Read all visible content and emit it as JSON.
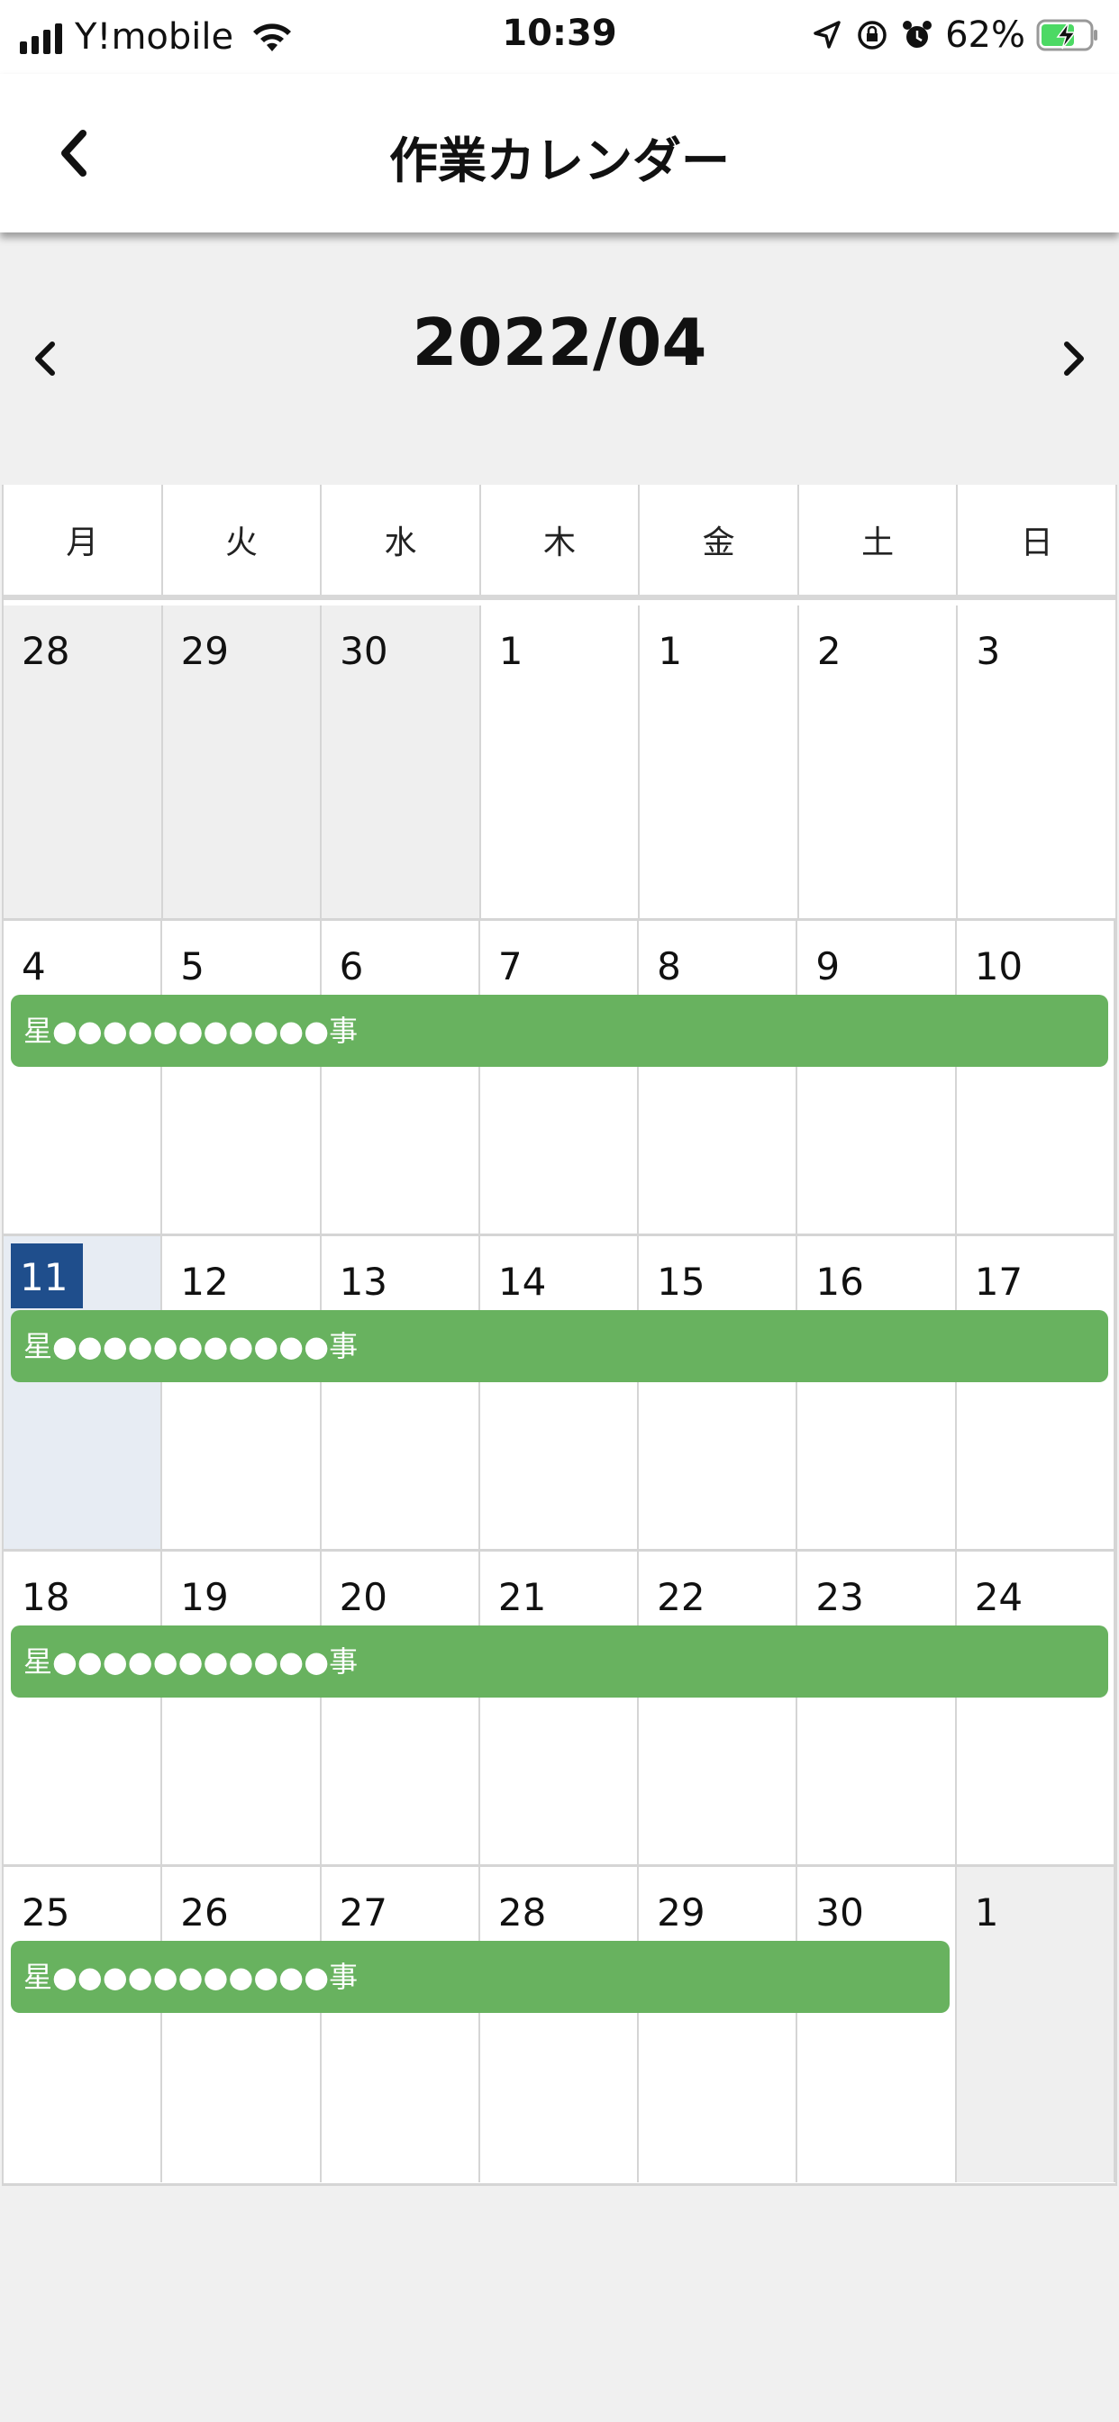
{
  "status_bar": {
    "carrier": "Y!mobile",
    "time": "10:39",
    "battery": "62%"
  },
  "header": {
    "title": "作業カレンダー",
    "back_icon": "chevron-left-icon"
  },
  "calendar": {
    "month": "2022/04",
    "weekdays": [
      "月",
      "火",
      "水",
      "木",
      "金",
      "土",
      "日"
    ],
    "weeks": [
      {
        "days": [
          {
            "label": "28",
            "state": "other"
          },
          {
            "label": "29",
            "state": "other"
          },
          {
            "label": "30",
            "state": "other"
          },
          {
            "label": "1",
            "state": "current"
          },
          {
            "label": "1",
            "state": "current"
          },
          {
            "label": "2",
            "state": "current"
          },
          {
            "label": "3",
            "state": "current"
          }
        ]
      },
      {
        "days": [
          {
            "label": "4",
            "state": "current"
          },
          {
            "label": "5",
            "state": "current"
          },
          {
            "label": "6",
            "state": "current"
          },
          {
            "label": "7",
            "state": "current"
          },
          {
            "label": "8",
            "state": "current"
          },
          {
            "label": "9",
            "state": "current"
          },
          {
            "label": "10",
            "state": "current"
          }
        ],
        "event": {
          "title": "星●●●●●●●●●●●事",
          "span_days": 7
        }
      },
      {
        "days": [
          {
            "label": "11",
            "state": "today"
          },
          {
            "label": "12",
            "state": "current"
          },
          {
            "label": "13",
            "state": "current"
          },
          {
            "label": "14",
            "state": "current"
          },
          {
            "label": "15",
            "state": "current"
          },
          {
            "label": "16",
            "state": "current"
          },
          {
            "label": "17",
            "state": "current"
          }
        ],
        "event": {
          "title": "星●●●●●●●●●●●事",
          "span_days": 7
        }
      },
      {
        "days": [
          {
            "label": "18",
            "state": "current"
          },
          {
            "label": "19",
            "state": "current"
          },
          {
            "label": "20",
            "state": "current"
          },
          {
            "label": "21",
            "state": "current"
          },
          {
            "label": "22",
            "state": "current"
          },
          {
            "label": "23",
            "state": "current"
          },
          {
            "label": "24",
            "state": "current"
          }
        ],
        "event": {
          "title": "星●●●●●●●●●●●事",
          "span_days": 7
        }
      },
      {
        "days": [
          {
            "label": "25",
            "state": "current"
          },
          {
            "label": "26",
            "state": "current"
          },
          {
            "label": "27",
            "state": "current"
          },
          {
            "label": "28",
            "state": "current"
          },
          {
            "label": "29",
            "state": "current"
          },
          {
            "label": "30",
            "state": "current"
          },
          {
            "label": "1",
            "state": "other"
          }
        ],
        "event": {
          "title": "星●●●●●●●●●●●事",
          "span_days": 6
        }
      }
    ]
  },
  "colors": {
    "event": "#68b25f",
    "today_badge": "#1f4e8c",
    "today_cell": "#e7ecf3",
    "other_month_cell": "#efefef"
  }
}
